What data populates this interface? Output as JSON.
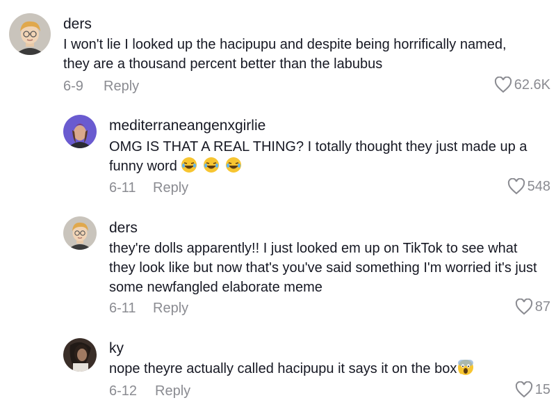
{
  "comments": [
    {
      "username": "ders",
      "text": "I won't lie I looked up the hacipupu and despite being horrifically named, they are a thousand percent better than the labubus",
      "date": "6-9",
      "reply_label": "Reply",
      "likes": "62.6K"
    },
    {
      "username": "mediterraneangenxgirlie",
      "text": "OMG IS THAT A REAL THING? I totally thought they just made up a funny word",
      "emoji": [
        "laughing-face",
        "laughing-face",
        "laughing-face"
      ],
      "date": "6-11",
      "reply_label": "Reply",
      "likes": "548"
    },
    {
      "username": "ders",
      "text": "they're dolls apparently!! I just looked em up on TikTok to see what they look like but now that's you've said something I'm worried it's just some newfangled elaborate meme",
      "date": "6-11",
      "reply_label": "Reply",
      "likes": "87"
    },
    {
      "username": "ky",
      "text": "nope theyre actually called hacipupu it says it on the box",
      "emoji": [
        "screaming-face"
      ],
      "date": "6-12",
      "reply_label": "Reply",
      "likes": "15"
    }
  ],
  "colors": {
    "text": "#161823",
    "secondary": "#8a8b91",
    "background": "#ffffff"
  }
}
